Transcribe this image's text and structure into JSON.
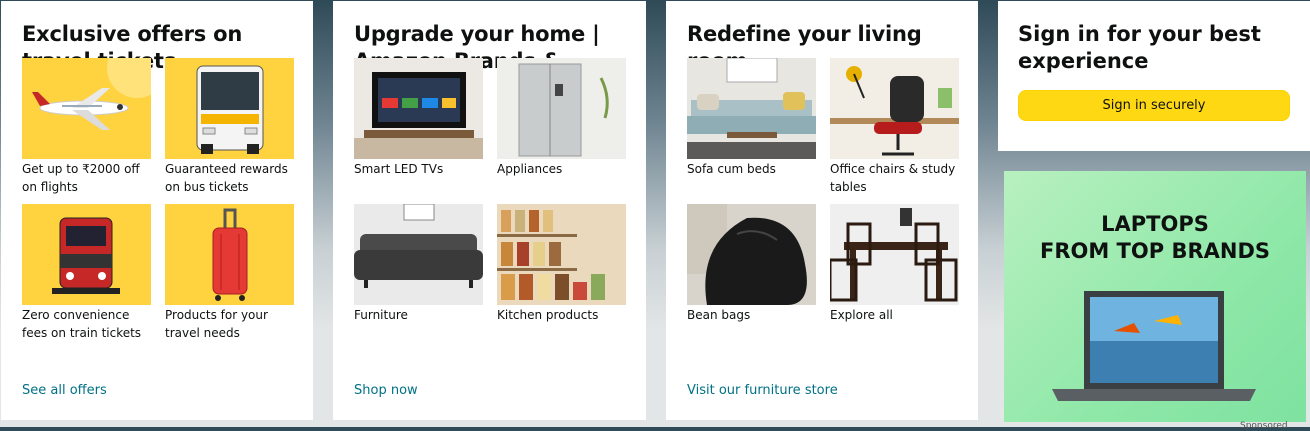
{
  "cards": [
    {
      "title": "Exclusive offers on travel tickets",
      "tiles": [
        {
          "caption": "Get up to ₹2000 off on flights"
        },
        {
          "caption": "Guaranteed rewards on bus tickets"
        },
        {
          "caption": "Zero convenience fees on train tickets"
        },
        {
          "caption": "Products for your travel needs"
        }
      ],
      "link": "See all offers"
    },
    {
      "title": "Upgrade your home | Amazon Brands & more",
      "tiles": [
        {
          "caption": "Smart LED TVs"
        },
        {
          "caption": "Appliances"
        },
        {
          "caption": "Furniture"
        },
        {
          "caption": "Kitchen products"
        }
      ],
      "link": "Shop now"
    },
    {
      "title": "Redefine your living room",
      "tiles": [
        {
          "caption": "Sofa cum beds"
        },
        {
          "caption": "Office chairs & study tables"
        },
        {
          "caption": "Bean bags"
        },
        {
          "caption": "Explore all"
        }
      ],
      "link": "Visit our furniture store"
    }
  ],
  "signin": {
    "title": "Sign in for your best experience",
    "button": "Sign in securely"
  },
  "ad": {
    "line1": "LAPTOPS",
    "line2": "FROM TOP BRANDS",
    "sponsored": "Sponsored"
  },
  "colors": {
    "link": "#007185",
    "button": "#ffd814",
    "tile_yellow": "#ffd23f"
  }
}
